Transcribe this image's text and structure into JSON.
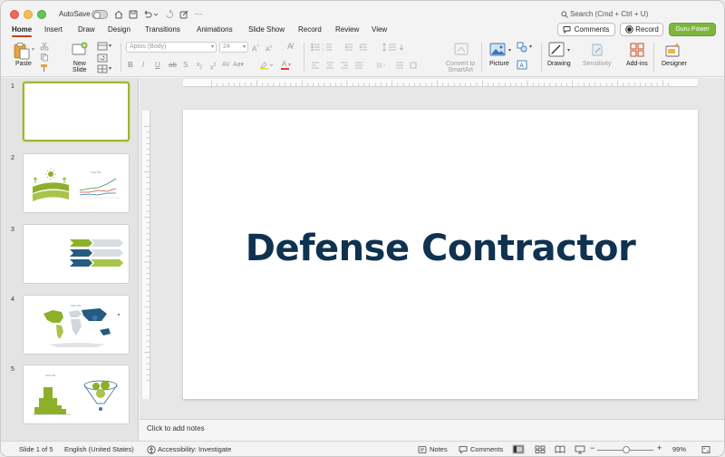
{
  "window": {
    "autosave_label": "AutoSave",
    "search_placeholder": "Search (Cmd + Ctrl + U)"
  },
  "tabs": [
    "Home",
    "Insert",
    "Draw",
    "Design",
    "Transitions",
    "Animations",
    "Slide Show",
    "Record",
    "Review",
    "View"
  ],
  "active_tab": "Home",
  "header_buttons": {
    "comments": "Comments",
    "record": "Record",
    "guru": "Guru Power"
  },
  "ribbon": {
    "paste": "Paste",
    "new_slide": "New\nSlide",
    "new_slide_l1": "New",
    "new_slide_l2": "Slide",
    "font_name": "Aptos (Body)",
    "font_size": "24",
    "convert_l1": "Convert to",
    "convert_l2": "SmartArt",
    "picture": "Picture",
    "drawing": "Drawing",
    "sensitivity": "Sensitivity",
    "addins": "Add-ins",
    "designer": "Designer"
  },
  "slides": [
    {
      "number": "1"
    },
    {
      "number": "2"
    },
    {
      "number": "3"
    },
    {
      "number": "4"
    },
    {
      "number": "5"
    }
  ],
  "slide": {
    "title": "Defense Contractor"
  },
  "notes_placeholder": "Click to add notes",
  "status": {
    "slide_count": "Slide 1 of 5",
    "language": "English (United States)",
    "accessibility": "Accessibility: Investigate",
    "notes": "Notes",
    "comments": "Comments",
    "zoom": "99%"
  },
  "colors": {
    "accent_tab": "#c43e1c",
    "guru": "#7fb53e",
    "title_text": "#0f3250",
    "thumb_green": "#8db02a",
    "thumb_blue": "#245b80"
  }
}
